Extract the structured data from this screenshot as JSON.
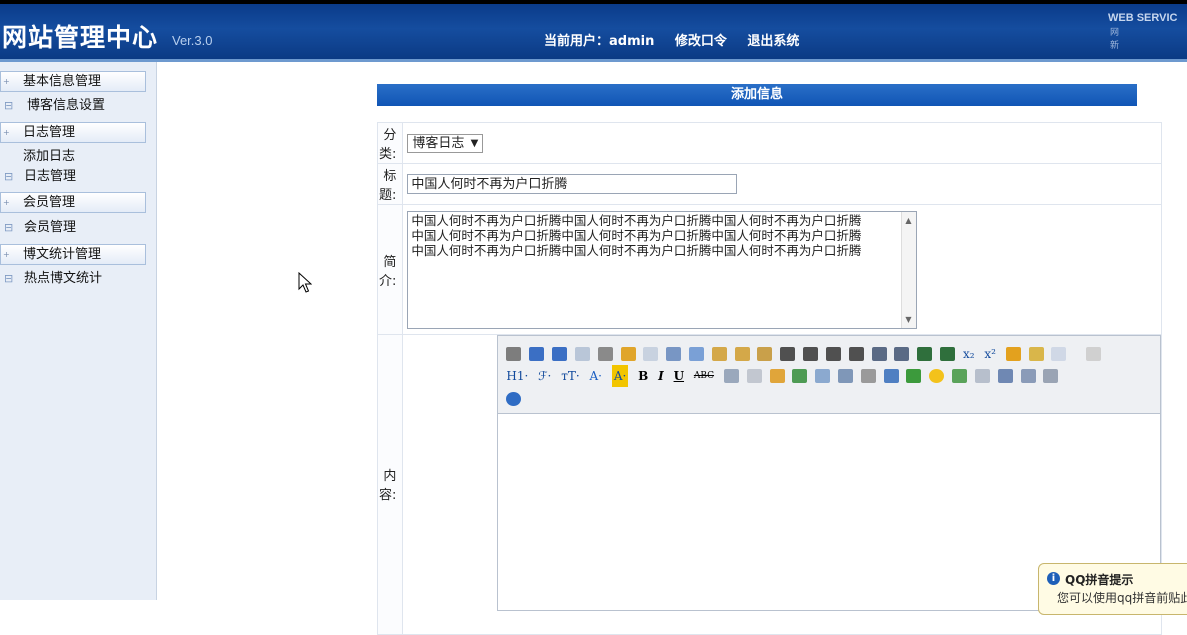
{
  "header": {
    "logo": "网站管理中心",
    "version": "Ver.3.0",
    "current_user": "当前用户：admin",
    "change_password": "修改口令",
    "logout": "退出系统",
    "brand": "WEB SERVIC",
    "brand_sub": "网 新"
  },
  "sidebar": {
    "items": [
      {
        "label": "基本信息管理"
      },
      {
        "label": "博客信息设置"
      },
      {
        "label": "日志管理"
      },
      {
        "label": "添加日志"
      },
      {
        "label": "日志管理"
      },
      {
        "label": "会员管理"
      },
      {
        "label": "会员管理"
      },
      {
        "label": "博文统计管理"
      },
      {
        "label": "热点博文统计"
      }
    ]
  },
  "form": {
    "title": "添加信息",
    "category_label": "分类:",
    "category_value": "博客日志",
    "title_label": "标题:",
    "title_value": "中国人何时不再为户口折腾",
    "summary_label": "简介:",
    "summary_lines": [
      "中国人何时不再为户口折腾中国人何时不再为户口折腾中国人何时不再为户口折腾",
      "中国人何时不再为户口折腾中国人何时不再为户口折腾中国人何时不再为户口折腾",
      "中国人何时不再为户口折腾中国人何时不再为户口折腾中国人何时不再为户口折腾"
    ],
    "content_label": "内容:"
  },
  "editor": {
    "heading_btn": "H1·",
    "font_btn": "ℱ·",
    "size_btn": "тT·",
    "color_btn": "A·",
    "bold": "B",
    "italic": "I",
    "underline": "U",
    "strike": "ABC",
    "sub": "x₂",
    "sup": "x²"
  },
  "qq_tip": {
    "title": "QQ拼音提示",
    "body": "您可以使用qq拼音前贴此"
  }
}
